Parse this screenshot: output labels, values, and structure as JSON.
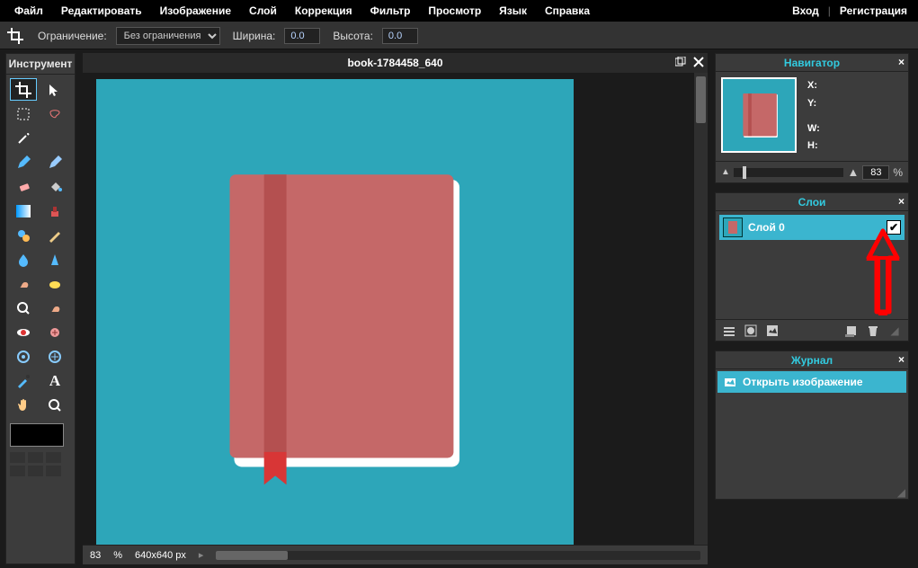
{
  "menu": [
    "Файл",
    "Редактировать",
    "Изображение",
    "Слой",
    "Коррекция",
    "Фильтр",
    "Просмотр",
    "Язык",
    "Справка"
  ],
  "auth": {
    "login": "Вход",
    "register": "Регистрация"
  },
  "optbar": {
    "constraint_label": "Ограничение:",
    "constraint_value": "Без ограничения",
    "width_label": "Ширина:",
    "width_value": "0.0",
    "height_label": "Высота:",
    "height_value": "0.0"
  },
  "tools_title": "Инструмент",
  "doc_title": "book-1784458_640",
  "status": {
    "zoom": "83",
    "percent_sign": "%",
    "dims": "640x640 px"
  },
  "panels": {
    "navigator": {
      "title": "Навигатор",
      "x_label": "X:",
      "y_label": "Y:",
      "w_label": "W:",
      "h_label": "H:",
      "zoom": "83",
      "percent": "%"
    },
    "layers": {
      "title": "Слои",
      "layer0": "Слой 0"
    },
    "history": {
      "title": "Журнал",
      "open_image": "Открыть изображение"
    }
  },
  "colors": {
    "canvas_bg": "#2da6b9",
    "book_cover": "#c56868",
    "book_dark": "#b45757",
    "ribbon": "#d63636",
    "accent": "#32cbe0"
  }
}
